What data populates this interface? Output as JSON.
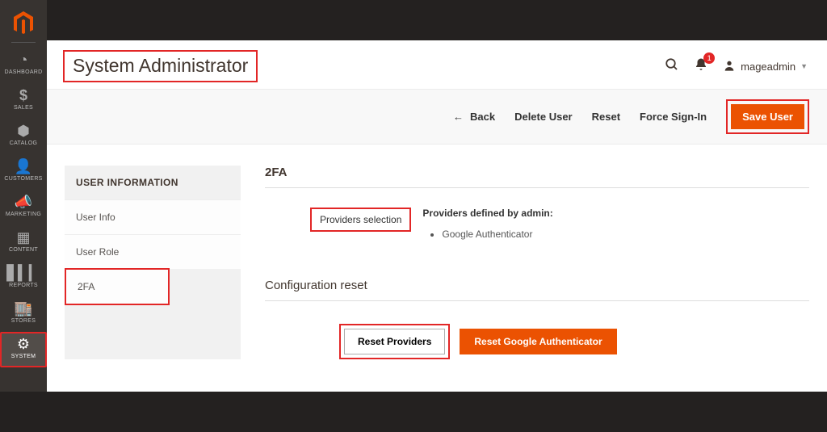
{
  "header": {
    "title": "System Administrator",
    "username": "mageadmin",
    "notif_count": "1"
  },
  "sidebar_nav": {
    "dashboard": "DASHBOARD",
    "sales": "SALES",
    "catalog": "CATALOG",
    "customers": "CUSTOMERS",
    "marketing": "MARKETING",
    "content": "CONTENT",
    "reports": "REPORTS",
    "stores": "STORES",
    "system": "SYSTEM"
  },
  "action_bar": {
    "back": "Back",
    "delete_user": "Delete User",
    "reset": "Reset",
    "force_signin": "Force Sign-In",
    "save_user": "Save User"
  },
  "side_panel": {
    "title": "USER INFORMATION",
    "user_info": "User Info",
    "user_role": "User Role",
    "twofa": "2FA"
  },
  "config": {
    "twofa_title": "2FA",
    "providers_selection_label": "Providers selection",
    "providers_defined_label": "Providers defined by admin:",
    "providers": [
      "Google Authenticator"
    ],
    "config_reset_title": "Configuration reset",
    "reset_providers_btn": "Reset Providers",
    "reset_google_btn": "Reset Google Authenticator"
  }
}
